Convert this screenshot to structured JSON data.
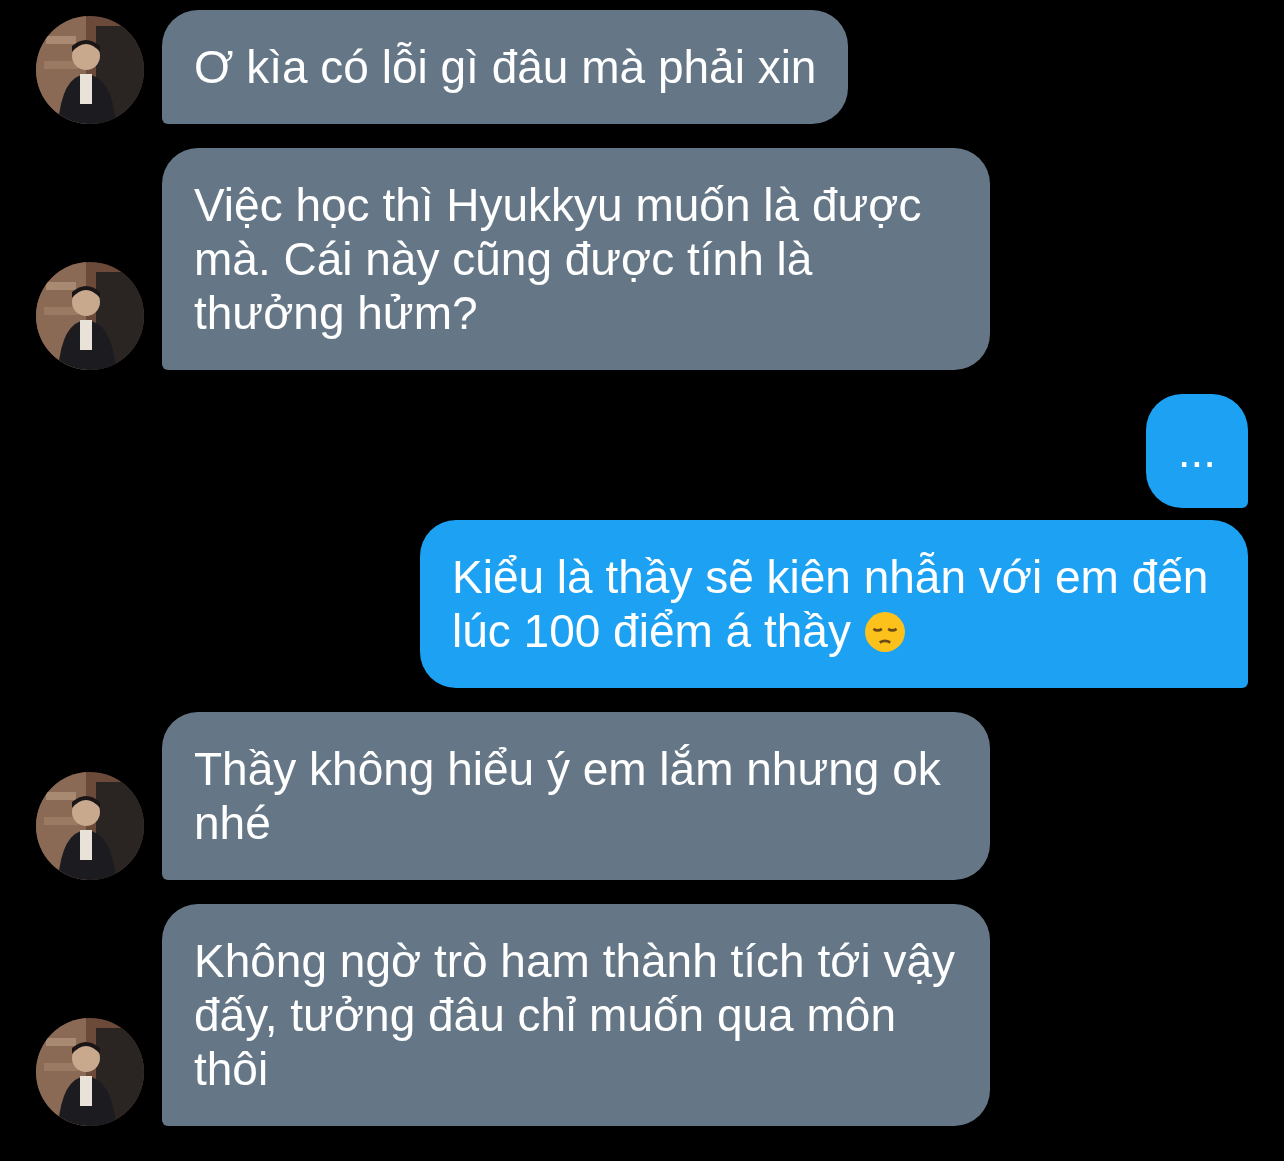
{
  "messages": [
    {
      "kind": "received",
      "text": "Ơ kìa có lỗi gì đâu mà phải xin"
    },
    {
      "kind": "received",
      "text": "Việc học thì Hyukkyu muốn là được mà. Cái này cũng được tính là thưởng hửm?"
    },
    {
      "kind": "sent",
      "text": "..."
    },
    {
      "kind": "sent",
      "text": "Kiểu là thầy sẽ kiên nhẫn với em đến lúc 100 điểm á thầy",
      "emoji": true
    },
    {
      "kind": "received",
      "text": "Thầy không hiểu ý em lắm nhưng ok nhé"
    },
    {
      "kind": "received",
      "text": "Không ngờ trò ham thành tích tới vậy đấy, tưởng đâu chỉ muốn qua môn thôi"
    }
  ]
}
